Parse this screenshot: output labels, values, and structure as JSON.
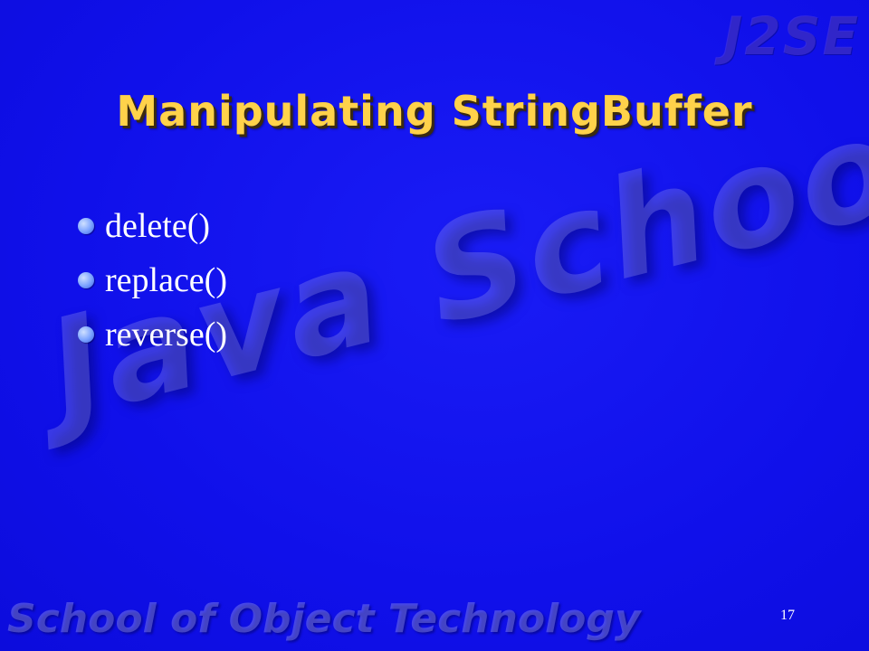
{
  "slide": {
    "watermark_top_right": "J2SE",
    "watermark_center": "Java School",
    "watermark_footer": "School of Object Technology",
    "title": "Manipulating StringBuffer",
    "bullets": [
      {
        "text": "delete()"
      },
      {
        "text": "replace()"
      },
      {
        "text": "reverse()"
      }
    ],
    "page_number": "17"
  },
  "colors": {
    "background": "#1212f0",
    "title": "#ffd24a",
    "bullet_text": "#ffffff",
    "bullet_dot": "#7aa2ff"
  }
}
